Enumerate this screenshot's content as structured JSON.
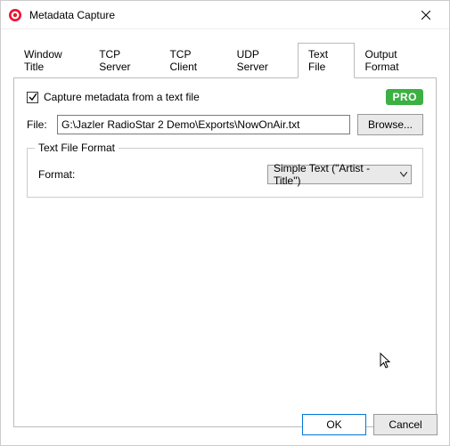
{
  "window": {
    "title": "Metadata Capture"
  },
  "tabs": [
    {
      "label": "Window Title"
    },
    {
      "label": "TCP Server"
    },
    {
      "label": "TCP Client"
    },
    {
      "label": "UDP Server"
    },
    {
      "label": "Text File"
    },
    {
      "label": "Output Format"
    }
  ],
  "active_tab": 4,
  "textfile": {
    "capture_label": "Capture metadata from a text file",
    "capture_checked": true,
    "pro_badge": "PRO",
    "file_label": "File:",
    "file_value": "G:\\Jazler RadioStar 2 Demo\\Exports\\NowOnAir.txt",
    "browse_label": "Browse...",
    "fieldset_legend": "Text File Format",
    "format_label": "Format:",
    "format_value": "Simple Text (\"Artist - Title\")"
  },
  "buttons": {
    "ok": "OK",
    "cancel": "Cancel"
  }
}
